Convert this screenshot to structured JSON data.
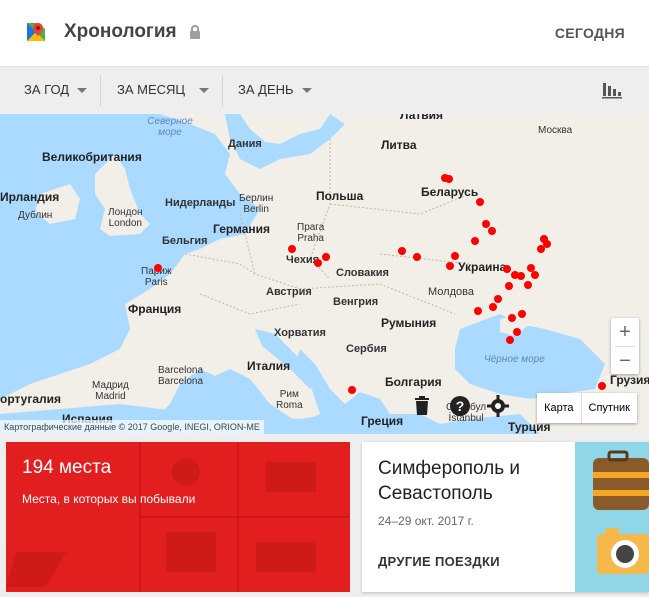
{
  "header": {
    "title": "Хронология",
    "today_label": "СЕГОДНЯ"
  },
  "toolbar": {
    "year_label": "ЗА ГОД",
    "month_label": "ЗА МЕСЯЦ",
    "day_label": "ЗА ДЕНЬ"
  },
  "map": {
    "labels": {
      "latvia": "Латвия",
      "lithuania": "Литва",
      "belarus": "Беларусь",
      "poland": "Польша",
      "ukraine": "Украина",
      "moldova": "Молдова",
      "romania": "Румыния",
      "bulgaria": "Болгария",
      "greece": "Греция",
      "turkey": "Турция",
      "georgia": "Грузия",
      "uk": "Великобритания",
      "ireland": "Ирландия",
      "netherlands": "Нидерланды",
      "belgium": "Бельгия",
      "germany": "Германия",
      "france": "Франция",
      "czech": "Чехия",
      "slovakia": "Словакия",
      "austria": "Австрия",
      "hungary": "Венгрия",
      "croatia": "Хорватия",
      "serbia": "Сербия",
      "italy": "Италия",
      "spain": "Испания",
      "portugal": "ортугалия",
      "denmark": "Дания",
      "north_sea": "Северное море",
      "black_sea": "Чёрное море",
      "moscow": "Москва",
      "dublin": "Дублин",
      "london": "Лондон\nLondon",
      "paris": "Париж\nParis",
      "berlin": "Берлин\nBerlin",
      "prague": "Прага\nPraha",
      "rome": "Рим\nRoma",
      "madrid": "Мадрид\nMadrid",
      "barcelona": "Barcelona\nBarcelona",
      "istanbul": "Стамбул\nİstanbul"
    },
    "zoom_in": "+",
    "zoom_out": "−",
    "map_type": "Карта",
    "satellite_type": "Спутник",
    "attribution": "Картографические данные © 2017 Google, INEGI, ORION-ME"
  },
  "places_card": {
    "count": "194 места",
    "subtitle": "Места, в которых вы побывали"
  },
  "trip_card": {
    "title": "Симферополь и Севастополь",
    "dates": "24–29 окт. 2017 г.",
    "more_label": "ДРУГИЕ ПОЕЗДКИ"
  },
  "colors": {
    "accent_red": "#e31e1e",
    "marker": "#ff0000",
    "water": "#aadaff",
    "land": "#f2efe9"
  }
}
